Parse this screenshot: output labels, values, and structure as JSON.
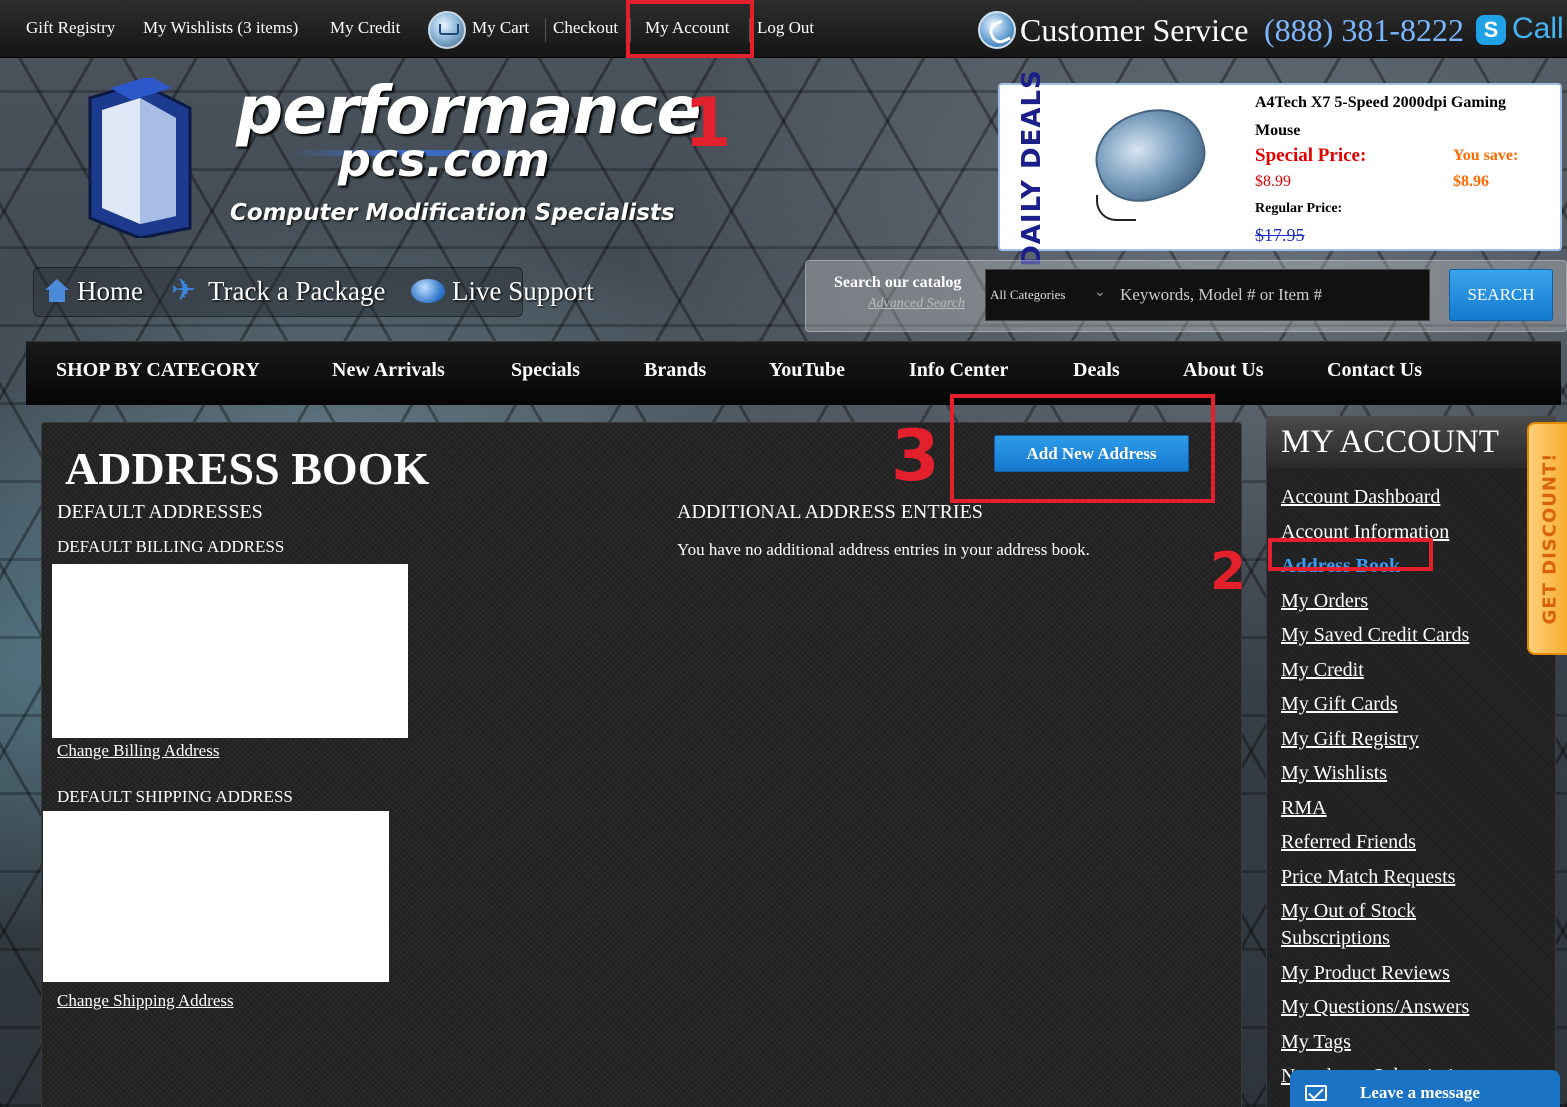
{
  "topbar": {
    "links": {
      "gift_registry": "Gift Registry",
      "wishlists": "My Wishlists (3 items)",
      "credit": "My Credit",
      "cart": "My Cart",
      "checkout": "Checkout",
      "account": "My Account",
      "logout": "Log Out"
    },
    "customer_service": {
      "label": "Customer Service",
      "phone": "(888) 381-8222",
      "call": "Call",
      "skype_glyph": "S"
    }
  },
  "logo": {
    "line1": "performance",
    "line2": "pcs.com",
    "tagline": "Computer Modification Specialists"
  },
  "daily_deal": {
    "tag": "DAILY DEALS",
    "product": "A4Tech X7 5-Speed 2000dpi Gaming Mouse",
    "special_label": "Special Price:",
    "special_price": "$8.99",
    "save_label": "You save:",
    "save_amount": "$8.96",
    "regular_label": "Regular Price:",
    "regular_price": "$17.95"
  },
  "home_nav": {
    "home": "Home",
    "track": "Track a Package",
    "support": "Live Support"
  },
  "search": {
    "label": "Search our catalog",
    "advanced": "Advanced Search",
    "category": "All Categories",
    "placeholder": "Keywords, Model # or Item #",
    "button": "SEARCH"
  },
  "categories": [
    "SHOP BY CATEGORY",
    "New Arrivals",
    "Specials",
    "Brands",
    "YouTube",
    "Info Center",
    "Deals",
    "About Us",
    "Contact Us"
  ],
  "main": {
    "title": "ADDRESS BOOK",
    "add_button": "Add New Address",
    "default_heading": "DEFAULT ADDRESSES",
    "billing_heading": "DEFAULT BILLING ADDRESS",
    "change_billing": "Change Billing Address",
    "shipping_heading": "DEFAULT SHIPPING ADDRESS",
    "change_shipping": "Change Shipping Address",
    "additional_heading": "ADDITIONAL ADDRESS ENTRIES",
    "additional_empty": "You have no additional address entries in your address book."
  },
  "sidebar": {
    "title": "MY ACCOUNT",
    "items": [
      "Account Dashboard",
      "Account Information",
      "Address Book",
      "My Orders",
      "My Saved Credit Cards",
      "My Credit",
      "My Gift Cards",
      "My Gift Registry",
      "My Wishlists",
      "RMA",
      "Referred Friends",
      "Price Match Requests",
      "My Out of Stock Subscriptions",
      "My Product Reviews",
      "My Questions/Answers",
      "My Tags",
      "Newsletter Subscriptions"
    ],
    "active_item": "Address Book"
  },
  "discount_tab": "GET DISCOUNT!",
  "chat": {
    "label": "Leave a message"
  },
  "annotations": {
    "step1": "1",
    "step2": "2",
    "step3": "3"
  },
  "colors": {
    "accent_blue": "#1478cf",
    "annotation_red": "#e3202b",
    "deal_red": "#e10000",
    "save_orange": "#ff6a00"
  },
  "icons": [
    "cart-icon",
    "phone-icon",
    "skype-icon",
    "home-icon",
    "plane-icon",
    "chat-bubble-icon",
    "chevron-down-icon",
    "envelope-icon"
  ]
}
